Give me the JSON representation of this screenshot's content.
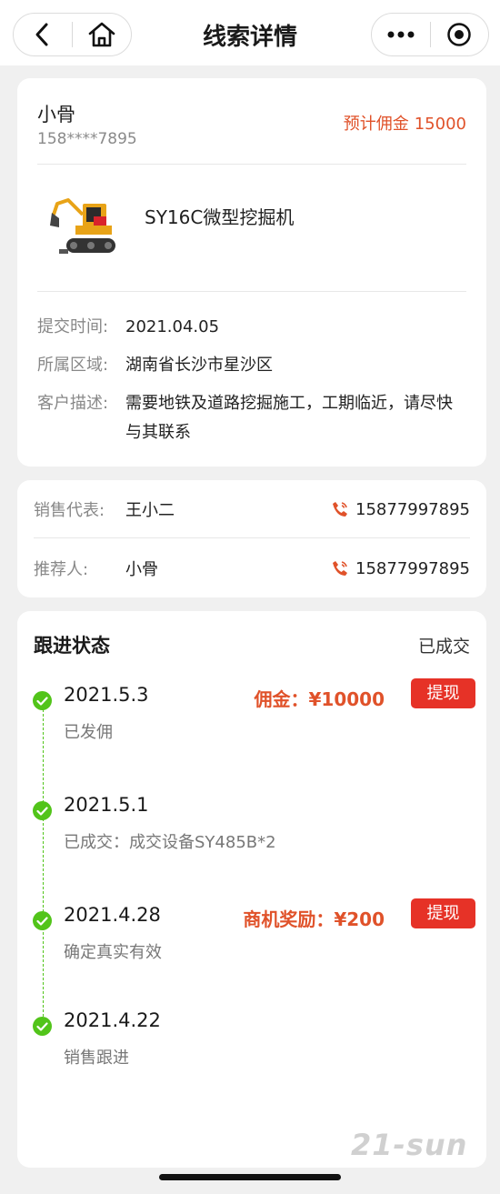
{
  "nav": {
    "title": "线索详情",
    "back_icon": "chevron-left-icon",
    "home_icon": "home-icon",
    "more_icon": "more-icon",
    "close_icon": "target-icon"
  },
  "customer": {
    "name": "小骨",
    "phone": "158****7895",
    "commission_label": "预计佣金",
    "commission_value": "15000"
  },
  "product": {
    "image_icon": "excavator-icon",
    "name": "SY16C微型挖掘机"
  },
  "details": [
    {
      "label": "提交时间:",
      "value": "2021.04.05"
    },
    {
      "label": "所属区域:",
      "value": "湖南省长沙市星沙区"
    },
    {
      "label": "客户描述:",
      "value": "需要地铁及道路挖掘施工，工期临近，请尽快与其联系"
    }
  ],
  "contacts": [
    {
      "label": "销售代表:",
      "name": "王小二",
      "phone": "15877997895",
      "icon": "phone-icon"
    },
    {
      "label": "推荐人:",
      "name": "小骨",
      "phone": "15877997895",
      "icon": "phone-icon"
    }
  ],
  "status": {
    "title": "跟进状态",
    "value": "已成交",
    "timeline": [
      {
        "date": "2021.5.3",
        "desc": "已发佣",
        "reward": "佣金：¥10000",
        "button": "提现"
      },
      {
        "date": "2021.5.1",
        "desc": "已成交：成交设备SY485B*2"
      },
      {
        "date": "2021.4.28",
        "desc": "确定真实有效",
        "reward": "商机奖励：¥200",
        "button": "提现"
      },
      {
        "date": "2021.4.22",
        "desc": "销售跟进"
      }
    ]
  },
  "watermark": "21-sun",
  "colors": {
    "accent": "#e0522a",
    "button_red": "#e63227",
    "timeline_green": "#52c41a"
  }
}
